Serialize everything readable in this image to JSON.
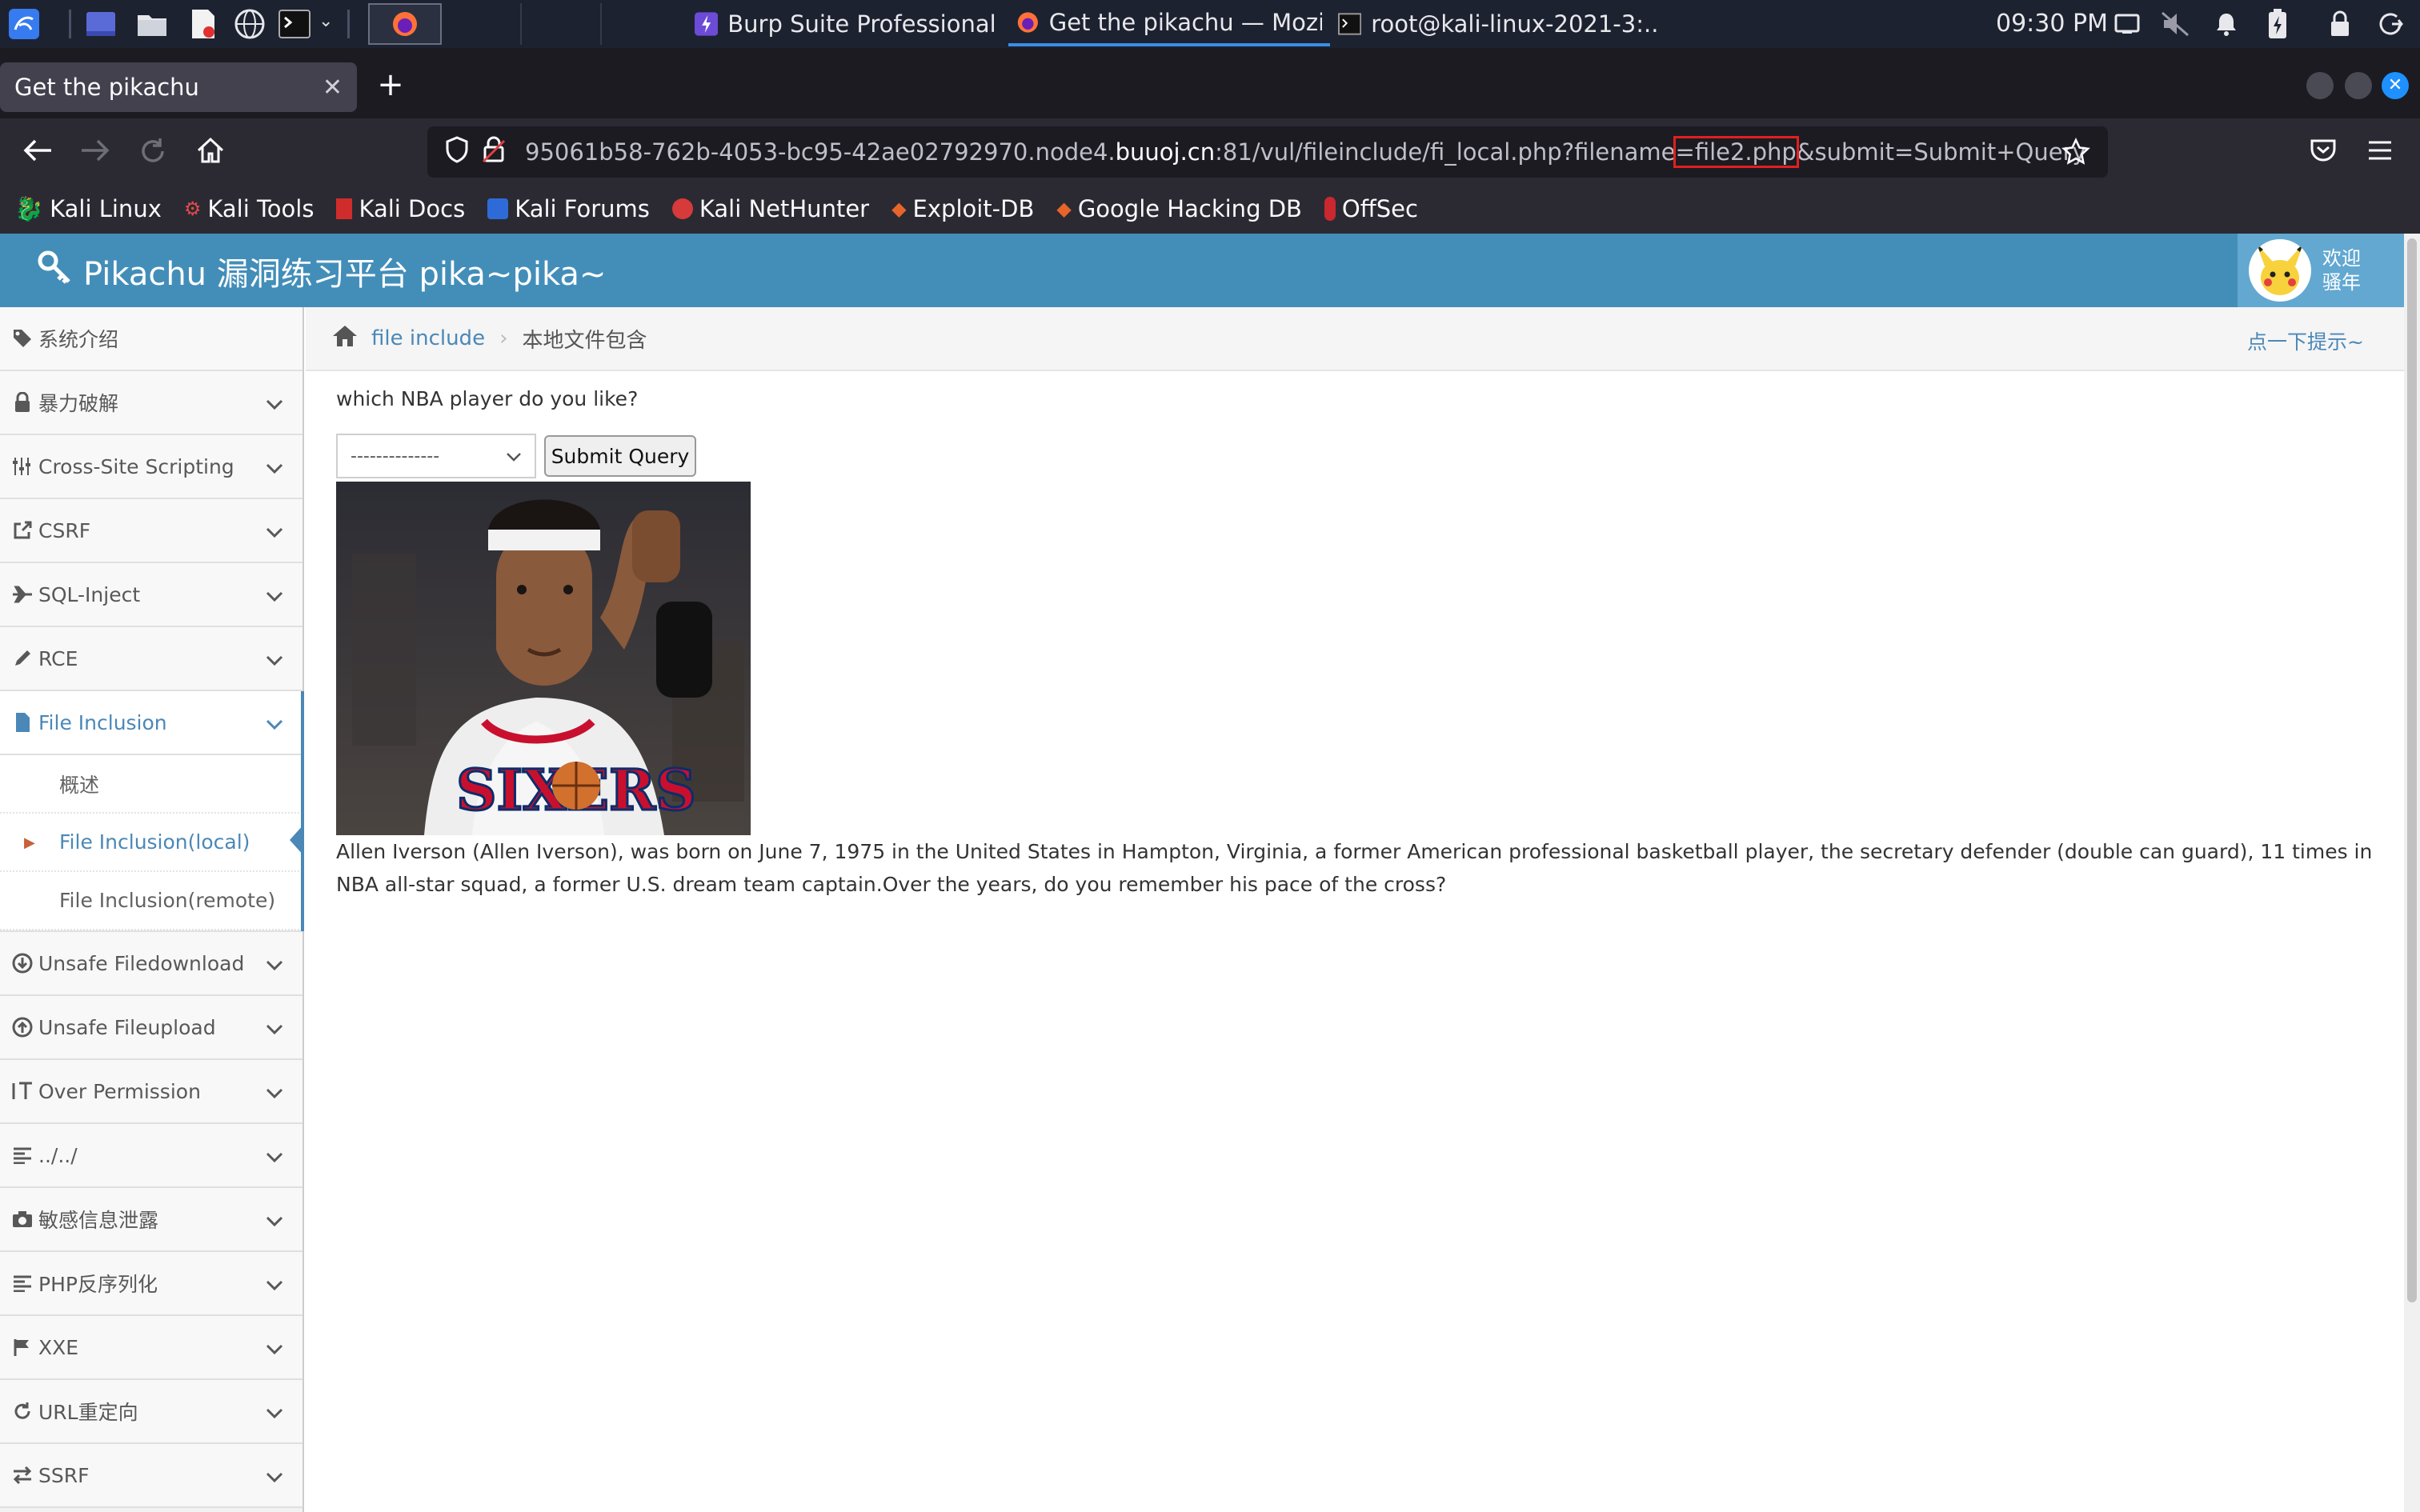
{
  "taskbar": {
    "windows": [
      {
        "title": "Burp Suite Professional ..."
      },
      {
        "title": "Get the pikachu — Mozil..."
      },
      {
        "title": "root@kali-linux-2021-3:..."
      }
    ],
    "clock": "09:30 PM"
  },
  "browser": {
    "tab_title": "Get the pikachu",
    "url": {
      "prefix": "95061b58-762b-4053-bc95-42ae02792970.node4.",
      "domain": "buuoj.cn",
      "path": ":81/vul/fileinclude/fi_local.php?filename",
      "highlight": "=file2.php",
      "suffix": "&submit=Submit+Query"
    },
    "bookmarks": [
      "Kali Linux",
      "Kali Tools",
      "Kali Docs",
      "Kali Forums",
      "Kali NetHunter",
      "Exploit-DB",
      "Google Hacking DB",
      "OffSec"
    ]
  },
  "app": {
    "title": "Pikachu 漏洞练习平台 pika~pika~",
    "welcome_line1": "欢迎",
    "welcome_line2": "骚年"
  },
  "sidebar": {
    "items": [
      {
        "label": "系统介绍",
        "icon": "tag-icon"
      },
      {
        "label": "暴力破解",
        "icon": "lock-icon"
      },
      {
        "label": "Cross-Site Scripting",
        "icon": "sliders-icon"
      },
      {
        "label": "CSRF",
        "icon": "external-link-icon"
      },
      {
        "label": "SQL-Inject",
        "icon": "plane-icon"
      },
      {
        "label": "RCE",
        "icon": "pencil-icon"
      },
      {
        "label": "File Inclusion",
        "icon": "file-icon"
      },
      {
        "label": "Unsafe Filedownload",
        "icon": "download-circle-icon"
      },
      {
        "label": "Unsafe Fileupload",
        "icon": "upload-circle-icon"
      },
      {
        "label": "Over Permission",
        "icon": "text-height-icon"
      },
      {
        "label": "../../",
        "icon": "align-left-icon"
      },
      {
        "label": "敏感信息泄露",
        "icon": "camera-icon"
      },
      {
        "label": "PHP反序列化",
        "icon": "align-left-icon"
      },
      {
        "label": "XXE",
        "icon": "flag-icon"
      },
      {
        "label": "URL重定向",
        "icon": "refresh-icon"
      },
      {
        "label": "SSRF",
        "icon": "exchange-icon"
      }
    ],
    "subitems": [
      "概述",
      "File Inclusion(local)",
      "File Inclusion(remote)"
    ]
  },
  "breadcrumb": {
    "parent": "file include",
    "current": "本地文件包含",
    "hint": "点一下提示~"
  },
  "main": {
    "question": "which NBA player do you like?",
    "select_value": "--------------",
    "submit_label": "Submit Query",
    "description": "Allen Iverson (Allen Iverson), was born on June 7, 1975 in the United States in Hampton, Virginia, a former American professional basketball player, the secretary defender (double can guard), 11 times in NBA all-star squad, a former U.S. dream team captain.Over the years, do you remember his pace of the cross?"
  },
  "colors": {
    "header_bg": "#438eb9",
    "link_blue": "#4b88b7",
    "url_highlight_border": "#e02020"
  }
}
